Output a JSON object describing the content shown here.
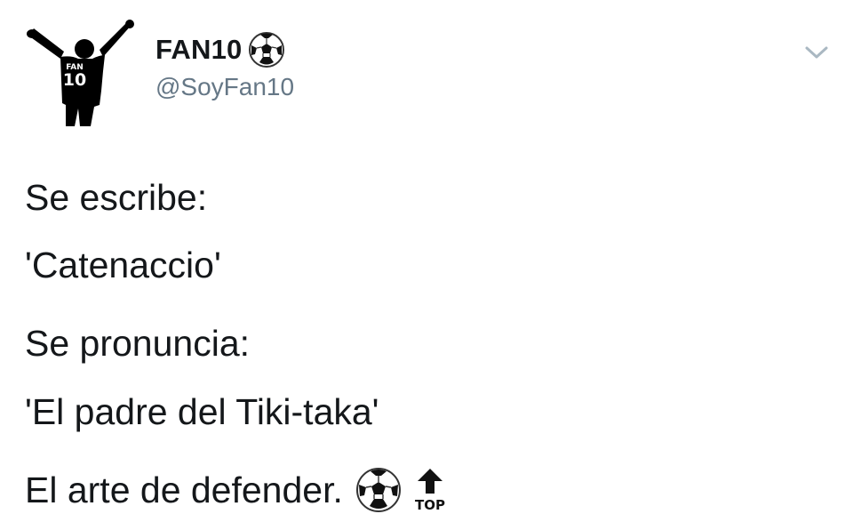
{
  "author": {
    "display_name": "FAN10",
    "handle": "@SoyFan10",
    "avatar_jersey_text_top": "FAN",
    "avatar_jersey_number": "10",
    "name_emoji_icon": "soccer-ball-icon"
  },
  "menu": {
    "icon": "chevron-down-icon"
  },
  "tweet": {
    "lines": [
      "Se escribe:",
      "'Catenaccio'",
      "Se pronuncia:",
      "'El padre del Tiki-taka'",
      "El arte de defender."
    ],
    "trailing_emojis": [
      "soccer-ball-icon",
      "top-arrow-icon"
    ],
    "top_emoji_text": "TOP"
  },
  "colors": {
    "text": "#14171a",
    "secondary_text": "#657786",
    "caret": "#aab8c2",
    "background": "#ffffff"
  }
}
